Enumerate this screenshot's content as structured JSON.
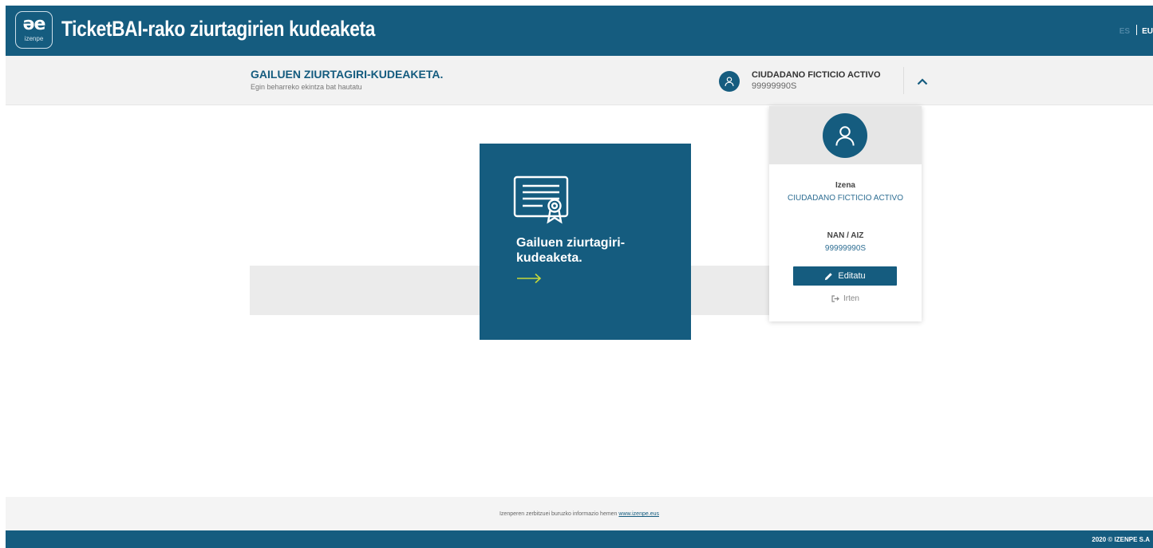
{
  "header": {
    "logo_mark": "əe",
    "logo_sub": "izenpe",
    "title": "TicketBAI-rako ziurtagirien kudeaketa",
    "languages": {
      "es": "ES",
      "eu": "EU"
    }
  },
  "subheader": {
    "title": "GAILUEN ZIURTAGIRI-KUDEAKETA.",
    "subtitle": "Egin beharreko ekintza bat hautatu",
    "user_name": "CIUDADANO FICTICIO ACTIVO",
    "user_id": "99999990S"
  },
  "card": {
    "icon": "certificate-icon",
    "title": "Gailuen ziurtagiri-kudeaketa."
  },
  "user_menu": {
    "name_label": "Izena",
    "name_value": "CIUDADANO FICTICIO ACTIVO",
    "id_label": "NAN / AIZ",
    "id_value": "99999990S",
    "edit_label": "Editatu",
    "logout_label": "Irten"
  },
  "footer": {
    "info_text": "Izenperen zerbitzuei buruzko informazio hemen",
    "info_link": "www.izenpe.eus",
    "copyright": "2020 © IZENPE S.A"
  },
  "colors": {
    "primary": "#155c7f",
    "accent_arrow": "#c6d83a",
    "light_bg": "#f2f2f2"
  }
}
